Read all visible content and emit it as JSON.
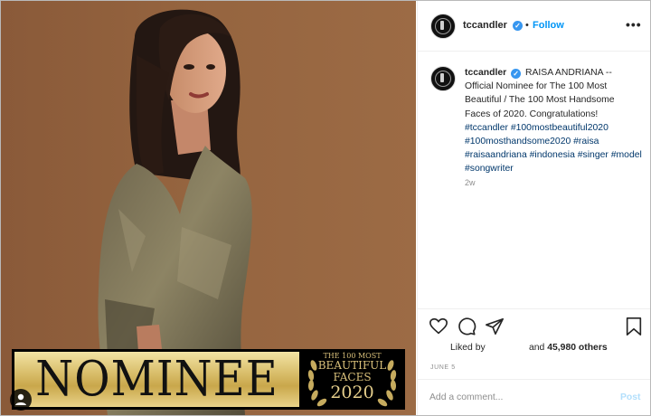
{
  "post": {
    "username": "tccandler",
    "follow_separator": "•",
    "follow_label": "Follow",
    "more_label": "•••",
    "caption_text": "RAISA ANDRIANA -- Official Nominee for The 100 Most Beautiful / The 100 Most Handsome Faces of 2020. Congratulations!",
    "hashtags": "#tccandler #100mostbeautiful2020 #100mosthandsome2020 #raisa #raisaandriana #indonesia #singer #model #songwriter",
    "time_ago": "2w",
    "likes_prefix": "Liked by",
    "likes_suffix_pre": "and",
    "likes_count": "45,980 others",
    "date": "JUNE 5",
    "comment_placeholder": "Add a comment...",
    "post_label": "Post"
  },
  "photo": {
    "banner_word": "NOMINEE",
    "badge_line1": "THE 100 MOST",
    "badge_line2": "BEAUTIFUL",
    "badge_line3": "FACES",
    "badge_year": "2020"
  },
  "icons": {
    "verified": "verified-badge-icon",
    "heart": "heart-icon",
    "comment": "comment-icon",
    "share": "share-icon",
    "save": "bookmark-icon",
    "tagged": "tagged-user-icon"
  },
  "colors": {
    "link": "#0095f6",
    "hashtag": "#00376b",
    "verified": "#3897f0",
    "gold": "#d8bd69"
  }
}
